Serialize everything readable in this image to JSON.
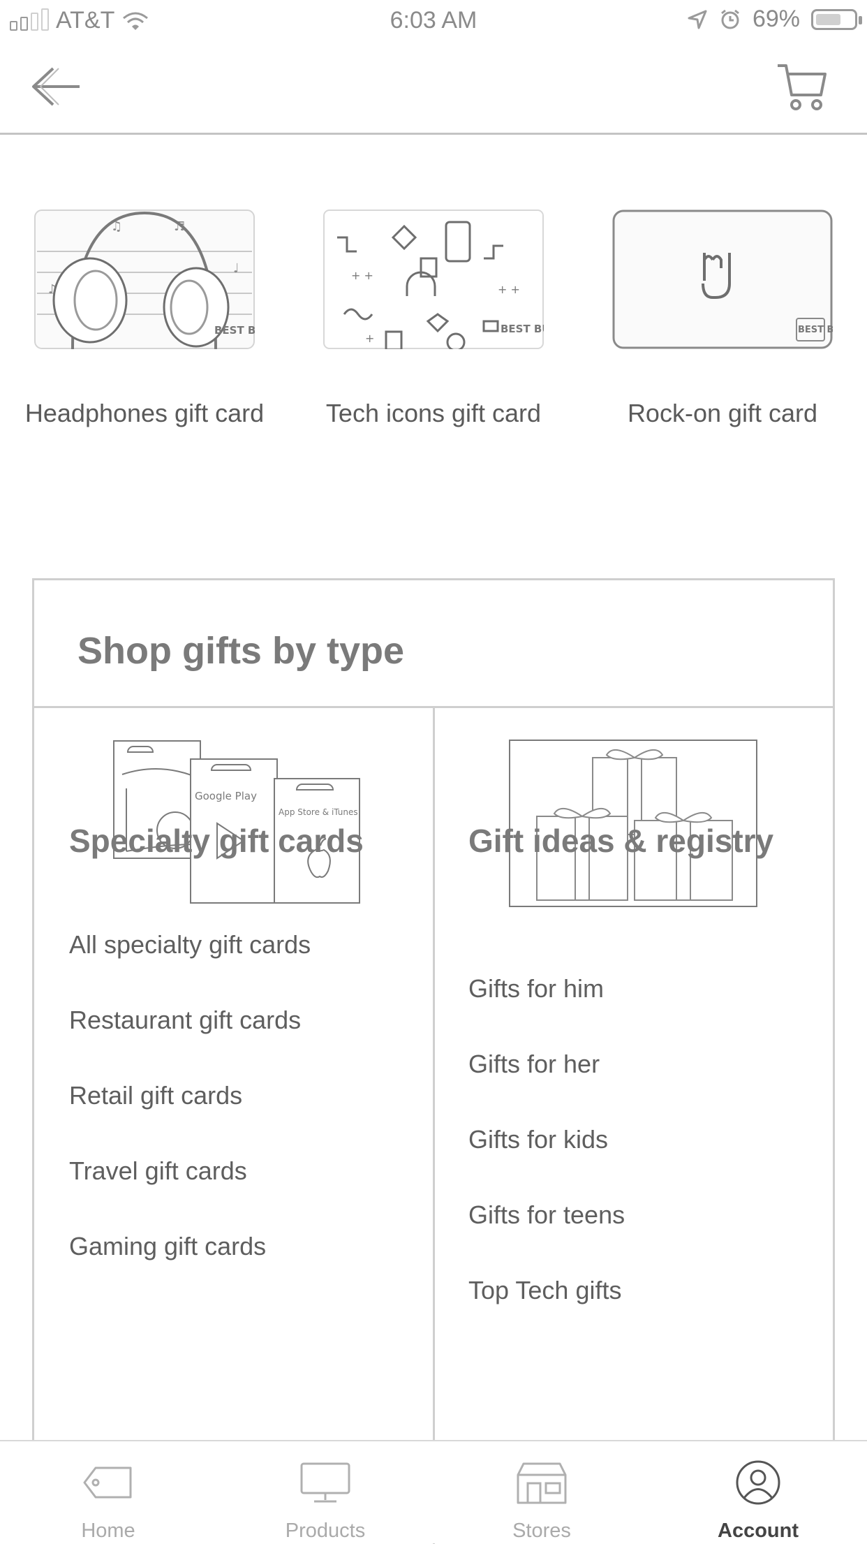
{
  "status_bar": {
    "carrier": "AT&T",
    "time": "6:03 AM",
    "battery": "69%",
    "battery_level": 0.69
  },
  "header": {
    "back_icon": "arrow-left-icon",
    "cart_icon": "cart-icon"
  },
  "gift_cards": [
    {
      "label": "Headphones gift card",
      "image": "headphones-card-art",
      "brand": "BEST BUY"
    },
    {
      "label": "Tech icons gift card",
      "image": "tech-icons-card-art",
      "brand": "BEST BUY"
    },
    {
      "label": "Rock-on gift card",
      "image": "rock-on-card-art",
      "brand": "BEST BUY"
    }
  ],
  "shop_by_type": {
    "title": "Shop gifts by type",
    "columns": [
      {
        "heading": "Specialty gift cards",
        "image": "specialty-gift-cards-art",
        "links": [
          "All specialty gift cards",
          "Restaurant gift cards",
          "Retail gift cards",
          "Travel gift cards",
          "Gaming gift cards"
        ]
      },
      {
        "heading": "Gift ideas & registry",
        "image": "gift-boxes-art",
        "links": [
          "Gifts for him",
          "Gifts for her",
          "Gifts for kids",
          "Gifts for teens",
          "Top Tech gifts"
        ]
      }
    ],
    "specialty_card_text": [
      "Google Play",
      "App Store & iTunes"
    ]
  },
  "bottom_nav": [
    {
      "label": "Home",
      "icon": "tag-icon",
      "active": false
    },
    {
      "label": "Products",
      "icon": "monitor-icon",
      "active": false
    },
    {
      "label": "Stores",
      "icon": "store-icon",
      "active": false
    },
    {
      "label": "Account",
      "icon": "account-icon",
      "active": true
    }
  ]
}
